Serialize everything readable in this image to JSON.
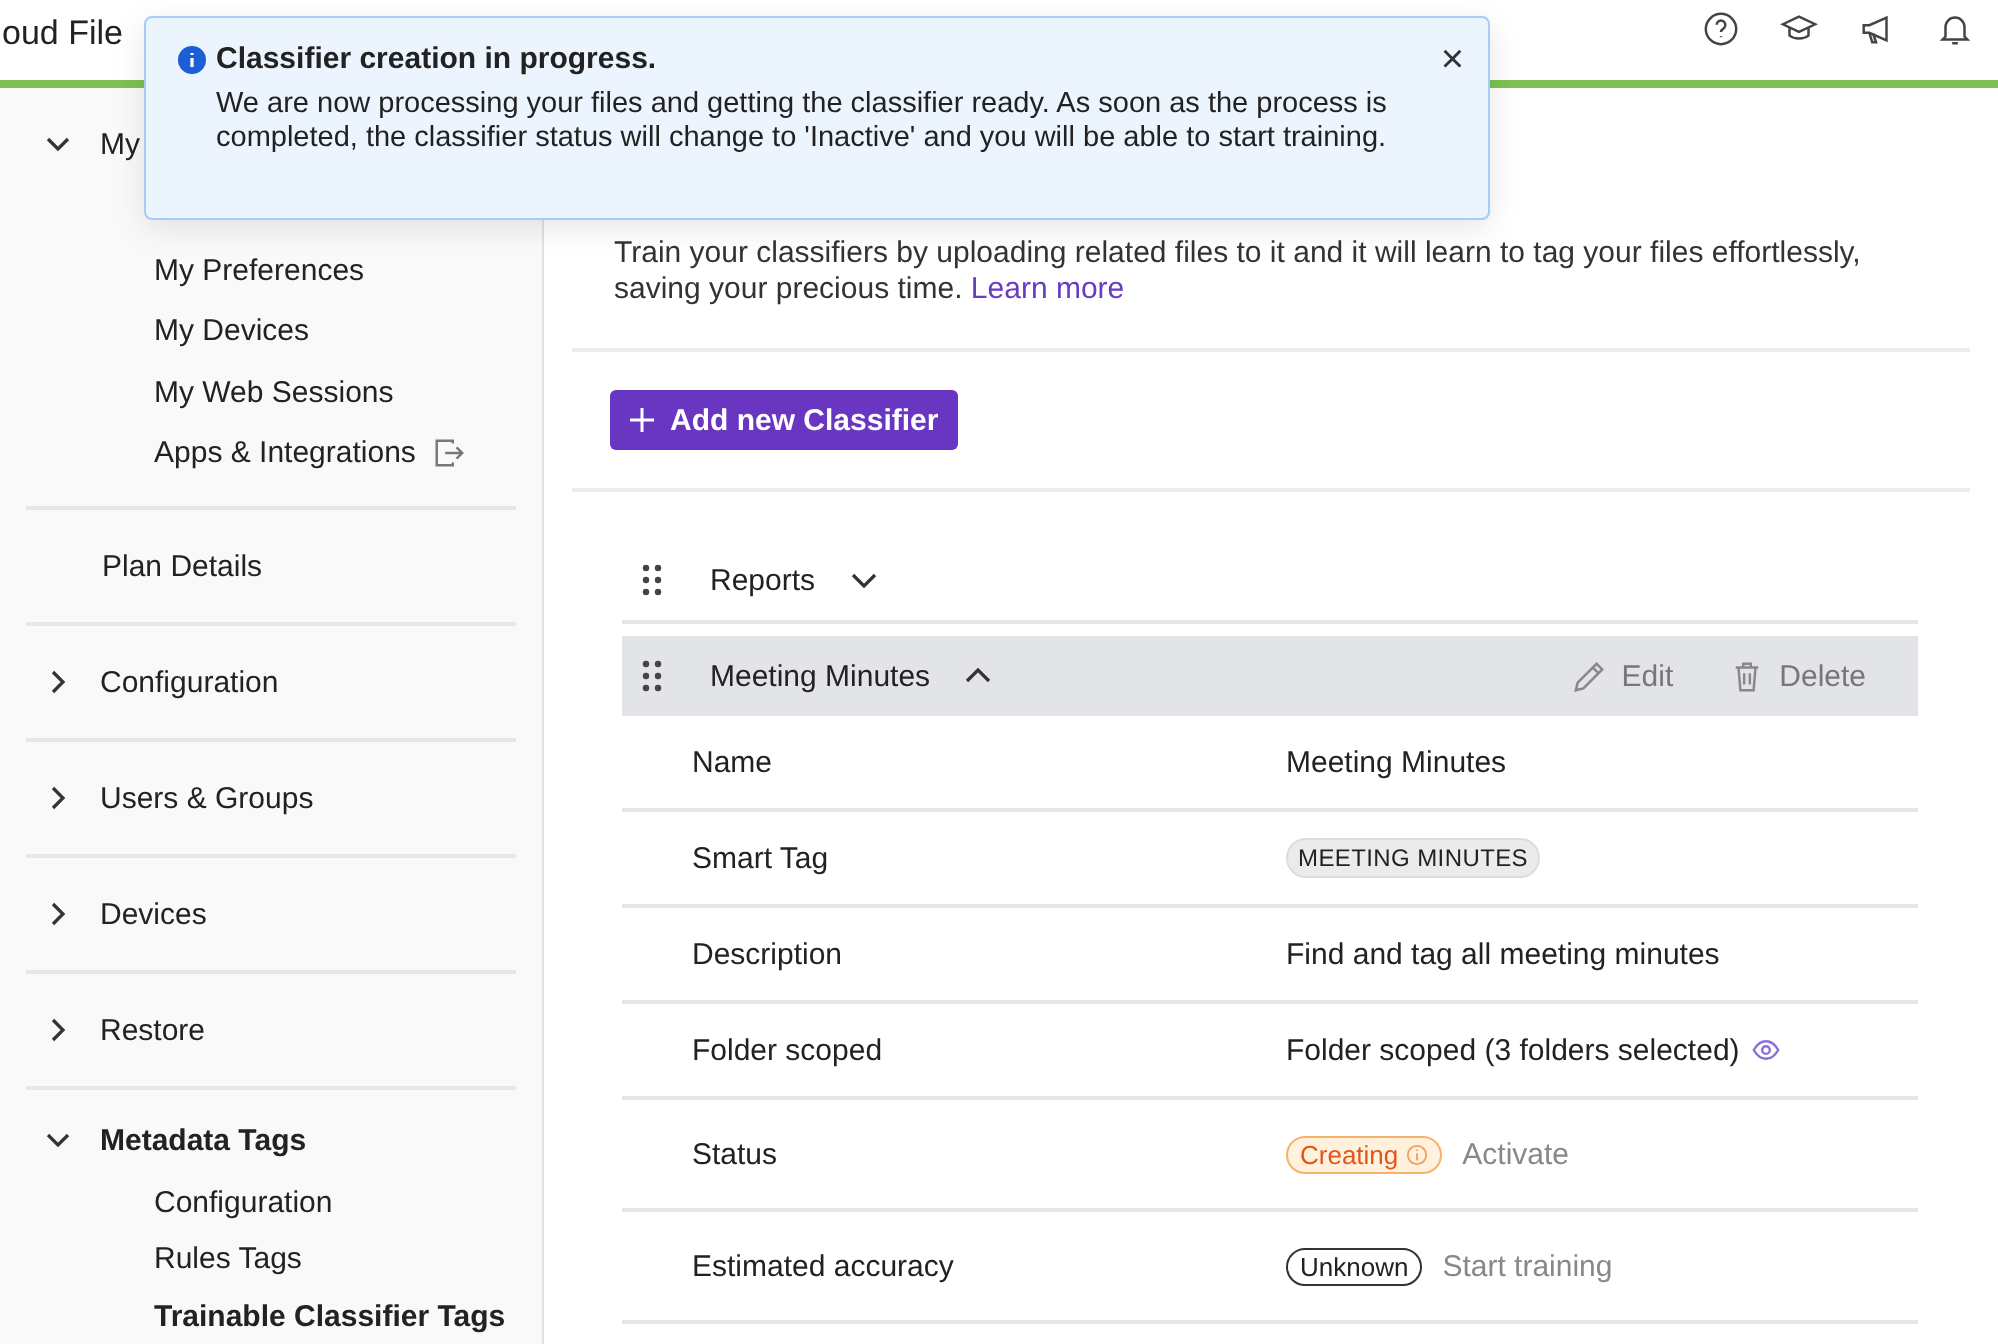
{
  "header": {
    "app_title": "oud File"
  },
  "toast": {
    "title": "Classifier creation in progress.",
    "message": "We are now processing your files and getting the classifier ready. As soon as the process is completed, the classifier status will change to 'Inactive' and you will be able to start training.",
    "close": "×"
  },
  "sidebar": {
    "sections": [
      {
        "label": "My",
        "kind": "group",
        "expanded": true,
        "children": [
          {
            "label": "My Preferences",
            "selected": false
          },
          {
            "label": "My Devices",
            "selected": false
          },
          {
            "label": "My Web Sessions",
            "selected": false
          },
          {
            "label": "Apps & Integrations",
            "selected": false,
            "external": true
          }
        ]
      },
      {
        "label": "Plan Details",
        "kind": "link"
      },
      {
        "label": "Configuration",
        "kind": "group",
        "expanded": false
      },
      {
        "label": "Users & Groups",
        "kind": "group",
        "expanded": false
      },
      {
        "label": "Devices",
        "kind": "group",
        "expanded": false
      },
      {
        "label": "Restore",
        "kind": "group",
        "expanded": false
      },
      {
        "label": "Metadata Tags",
        "kind": "group",
        "expanded": true,
        "children": [
          {
            "label": "Configuration",
            "selected": false
          },
          {
            "label": "Rules Tags",
            "selected": false
          },
          {
            "label": "Trainable Classifier Tags",
            "selected": true
          }
        ]
      }
    ]
  },
  "intro": {
    "lines": [
      "Train your classifiers by uploading related files to it and it will learn to tag your files effortlessly,",
      "saving your precious time."
    ],
    "link": "Learn more"
  },
  "add_button": "Add new Classifier",
  "classifiers": [
    {
      "name": "Reports",
      "expanded": false
    },
    {
      "name": "Meeting Minutes",
      "expanded": true,
      "actions": [
        "Edit",
        "Delete"
      ],
      "details": [
        {
          "label": "Name",
          "kind": "text",
          "value": "Meeting Minutes"
        },
        {
          "label": "Smart Tag",
          "kind": "tag",
          "value": "MEETING MINUTES"
        },
        {
          "label": "Description",
          "kind": "text",
          "value": "Find and tag all meeting minutes"
        },
        {
          "label": "Folder scoped",
          "kind": "scope",
          "value": "Folder scoped (3 folders selected)"
        },
        {
          "label": "Status",
          "kind": "status",
          "badge": "Creating",
          "action": "Activate"
        },
        {
          "label": "Estimated accuracy",
          "kind": "accuracy",
          "badge": "Unknown",
          "action": "Start training"
        }
      ]
    }
  ]
}
